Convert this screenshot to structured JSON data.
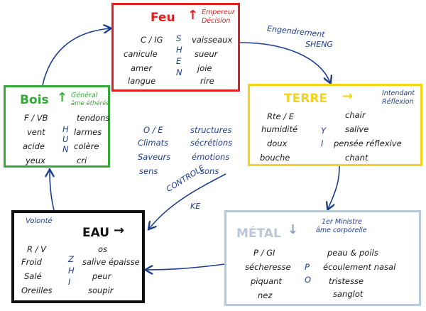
{
  "feu": {
    "title": "Feu",
    "arrow": "↑",
    "role": [
      "Empereur",
      "Décision"
    ],
    "col1": [
      "C / IG",
      "canicule",
      "amer",
      "langue"
    ],
    "code": [
      "S",
      "H",
      "E",
      "N"
    ],
    "col2": [
      "vaisseaux",
      "sueur",
      "joie",
      "rire"
    ]
  },
  "engendrement": {
    "line1": "Engendrement",
    "line2": "SHENG"
  },
  "terre": {
    "title": "TERRE",
    "arrow": "→",
    "role": [
      "Intendant",
      "Réflexion"
    ],
    "col1": [
      "Rte / E",
      "humidité",
      "doux",
      "bouche"
    ],
    "code": [
      "Y",
      "I"
    ],
    "col2": [
      "chair",
      "salive",
      "pensée réflexive",
      "chant"
    ]
  },
  "bois": {
    "title": "Bois",
    "arrow": "↑",
    "role": [
      "Général",
      "âme éthérée"
    ],
    "col1": [
      "F / VB",
      "vent",
      "acide",
      "yeux"
    ],
    "code": [
      "H",
      "U",
      "N"
    ],
    "col2": [
      "tendons",
      "larmes",
      "colère",
      "cri"
    ]
  },
  "center": {
    "left": [
      "O / E",
      "Climats",
      "Saveurs",
      "sens"
    ],
    "right": [
      "structures",
      "sécrétions",
      "émotions",
      "sons"
    ]
  },
  "controle": {
    "line1": "CONTROLE",
    "line2": "KE"
  },
  "eau": {
    "title": "EAU",
    "arrow": "→",
    "volonte": "Volonté",
    "col1": [
      "R / V",
      "Froid",
      "Salé",
      "Oreilles"
    ],
    "code": [
      "Z",
      "H",
      "I"
    ],
    "col2": [
      "os",
      "salive épaisse",
      "peur",
      "soupir"
    ]
  },
  "metal": {
    "title": "MÉTAL",
    "arrow": "↓",
    "role": [
      "1er Ministre",
      "âme corporelle"
    ],
    "col1": [
      "P / GI",
      "sécheresse",
      "piquant",
      "nez"
    ],
    "code": [
      "P",
      "O"
    ],
    "col2": [
      "peau & poils",
      "écoulement nasal",
      "tristesse",
      "sanglot"
    ]
  },
  "colors": {
    "feu": "#e02020",
    "terre": "#f4d417",
    "bois": "#37a83a",
    "eau": "#111111",
    "metal": "#b9c8d9",
    "ink": "#1d3d8f"
  }
}
